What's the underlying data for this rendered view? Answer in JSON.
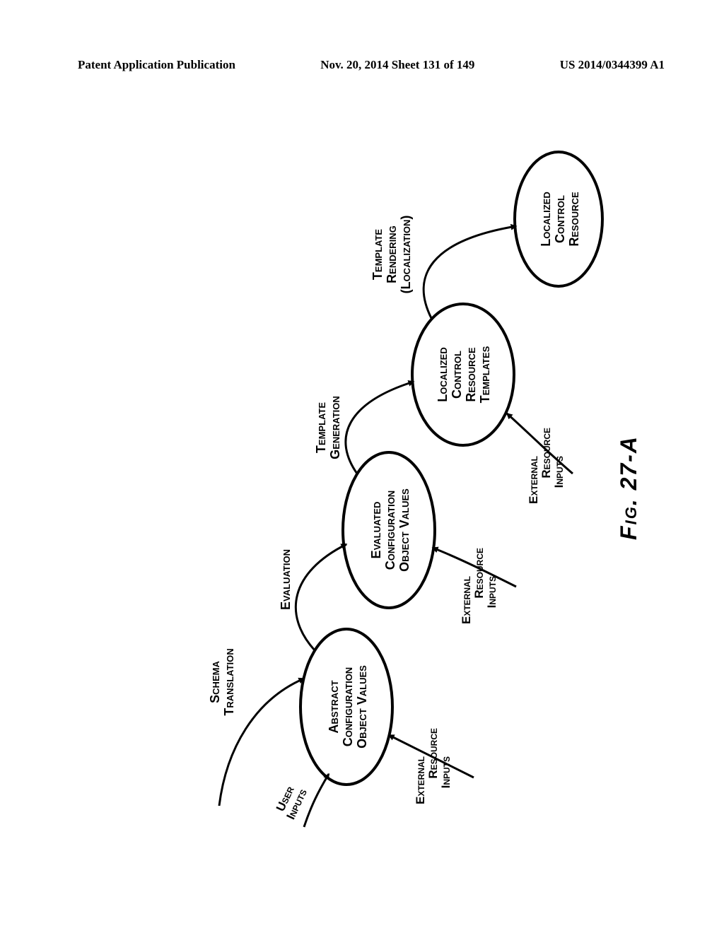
{
  "header": {
    "left": "Patent Application Publication",
    "center": "Nov. 20, 2014  Sheet 131 of 149",
    "right": "US 2014/0344399 A1"
  },
  "figure_title": "Fig. 27-A",
  "nodes": {
    "n1": {
      "line1": "Abstract",
      "line2": "Configuration",
      "line3": "Object Values"
    },
    "n2": {
      "line1": "Evaluated",
      "line2": "Configuration",
      "line3": "Object Values"
    },
    "n3": {
      "line1": "Localized",
      "line2": "Control",
      "line3": "Resource",
      "line4": "Templates"
    },
    "n4": {
      "line1": "Localized",
      "line2": "Control",
      "line3": "Resource"
    }
  },
  "edges": {
    "schema_translation": {
      "line1": "Schema",
      "line2": "Translation"
    },
    "evaluation": "Evaluation",
    "template_generation": {
      "line1": "Template",
      "line2": "Generation"
    },
    "template_rendering": {
      "line1": "Template",
      "line2": "Rendering",
      "line3": "(Localization)"
    },
    "user_inputs": {
      "line1": "User",
      "line2": "Inputs"
    },
    "ext_res_1": {
      "line1": "External",
      "line2": "Resource",
      "line3": "Inputs"
    },
    "ext_res_2": {
      "line1": "External",
      "line2": "Resource",
      "line3": "Inputs"
    },
    "ext_res_3": {
      "line1": "External",
      "line2": "Resource",
      "line3": "Inputs"
    }
  }
}
